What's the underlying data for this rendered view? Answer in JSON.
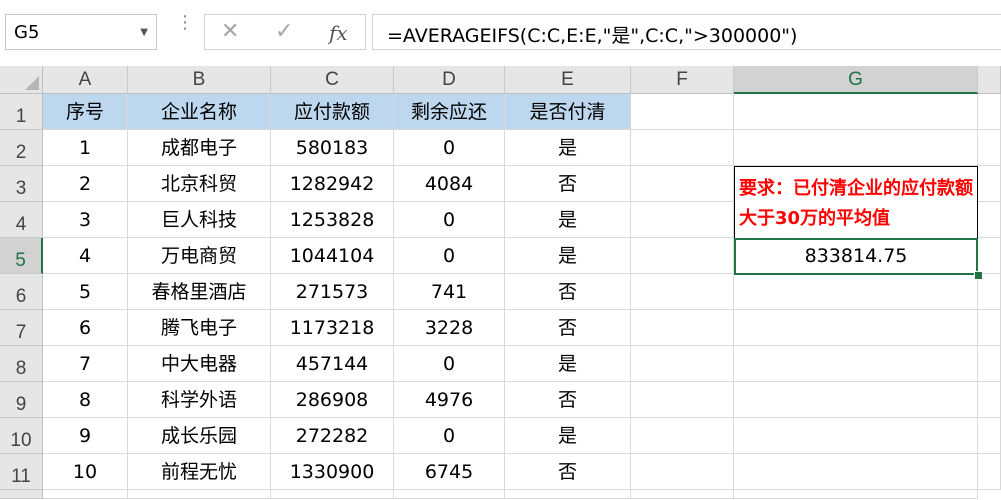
{
  "formula_bar": {
    "name_box": "G5",
    "cancel_icon": "✕",
    "enter_icon": "✓",
    "fx_label": "fx",
    "formula": "=AVERAGEIFS(C:C,E:E,\"是\",C:C,\">300000\")"
  },
  "columns": [
    "A",
    "B",
    "C",
    "D",
    "E",
    "F",
    "G"
  ],
  "selected_column": "G",
  "rows": [
    "1",
    "2",
    "3",
    "4",
    "5",
    "6",
    "7",
    "8",
    "9",
    "10",
    "11"
  ],
  "selected_row": "5",
  "table": {
    "headers": [
      "序号",
      "企业名称",
      "应付款额",
      "剩余应还",
      "是否付清"
    ],
    "data": [
      [
        "1",
        "成都电子",
        "580183",
        "0",
        "是"
      ],
      [
        "2",
        "北京科贸",
        "1282942",
        "4084",
        "否"
      ],
      [
        "3",
        "巨人科技",
        "1253828",
        "0",
        "是"
      ],
      [
        "4",
        "万电商贸",
        "1044104",
        "0",
        "是"
      ],
      [
        "5",
        "春格里酒店",
        "271573",
        "741",
        "否"
      ],
      [
        "6",
        "腾飞电子",
        "1173218",
        "3228",
        "否"
      ],
      [
        "7",
        "中大电器",
        "457144",
        "0",
        "是"
      ],
      [
        "8",
        "科学外语",
        "286908",
        "4976",
        "否"
      ],
      [
        "9",
        "成长乐园",
        "272282",
        "0",
        "是"
      ],
      [
        "10",
        "前程无忧",
        "1330900",
        "6745",
        "否"
      ]
    ]
  },
  "note_text": "要求：已付清企业的应付款额大于30万的平均值",
  "result_value": "833814.75",
  "colors": {
    "header_fill": "#bdd7ee",
    "note_text": "#ff0000",
    "selection": "#217346"
  }
}
